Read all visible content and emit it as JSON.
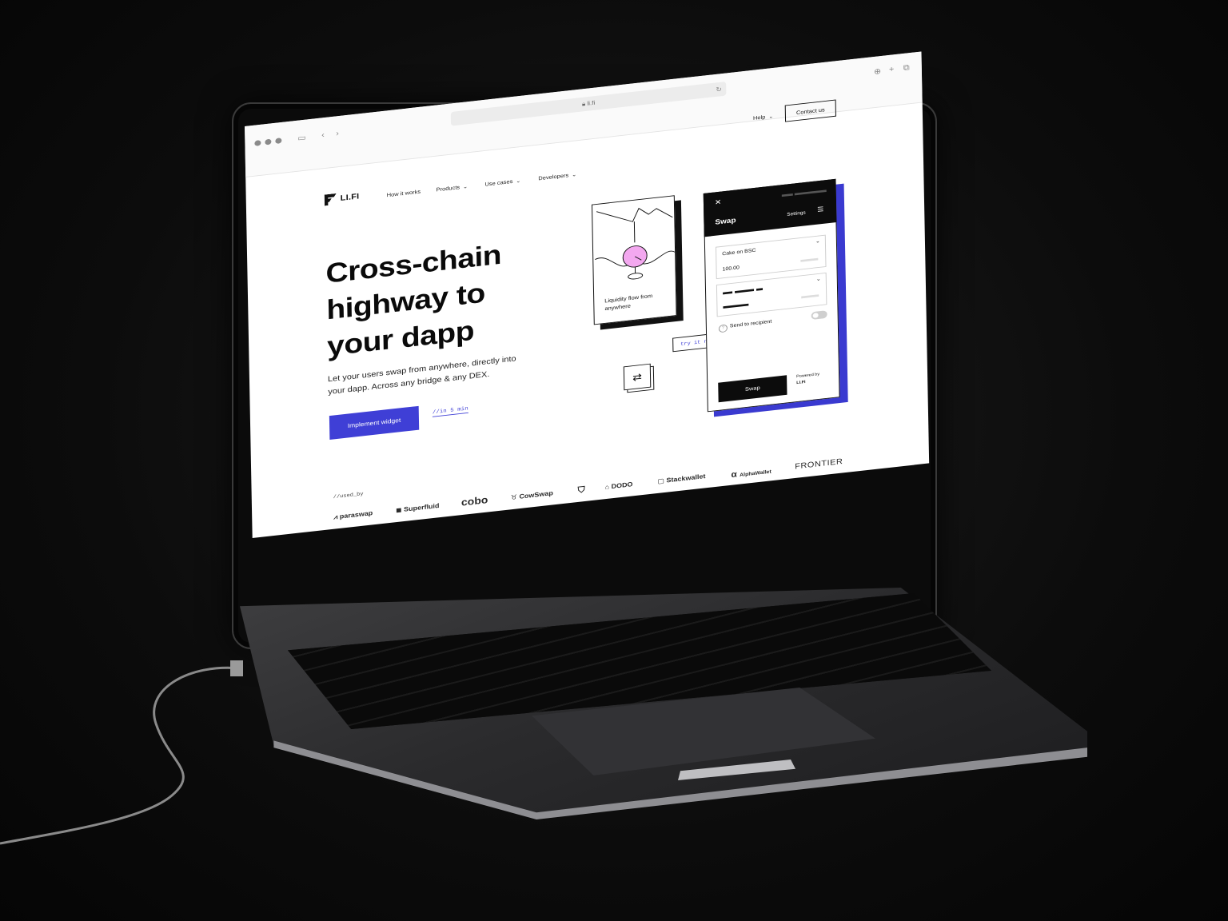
{
  "browser": {
    "url": "li.fi"
  },
  "nav": {
    "logo": "LI.FI",
    "items": [
      "How it works",
      "Products",
      "Use cases",
      "Developers"
    ],
    "help": "Help",
    "contact": "Contact us"
  },
  "hero": {
    "title_lines": [
      "Cross-chain",
      "highway to",
      "your dapp"
    ],
    "subtitle": "Let your users swap from anywhere, directly into your dapp. Across any bridge & any DEX.",
    "cta": "Implement widget",
    "cta_note": "//in 5 min"
  },
  "illustration": {
    "caption": "Liquidity flow from anywhere",
    "try_label": "try it now!"
  },
  "widget": {
    "title": "Swap",
    "settings": "Settings",
    "from_token": "Cake on BSC",
    "from_amount": "100.00",
    "send_to_recipient": "Send to recipient",
    "swap_button": "Swap",
    "powered_by": "Powered by",
    "powered_brand": "LI.FI"
  },
  "used_by": {
    "label": "//used_by",
    "partners": [
      "paraswap",
      "Superfluid",
      "cobo",
      "CowSwap",
      "DODO",
      "Stackwallet",
      "AlphaWallet",
      "FRONTIER"
    ]
  },
  "colors": {
    "accent": "#3f3fd6",
    "widget_header": "#0c0c0c",
    "orb": "#f3a8ef"
  }
}
